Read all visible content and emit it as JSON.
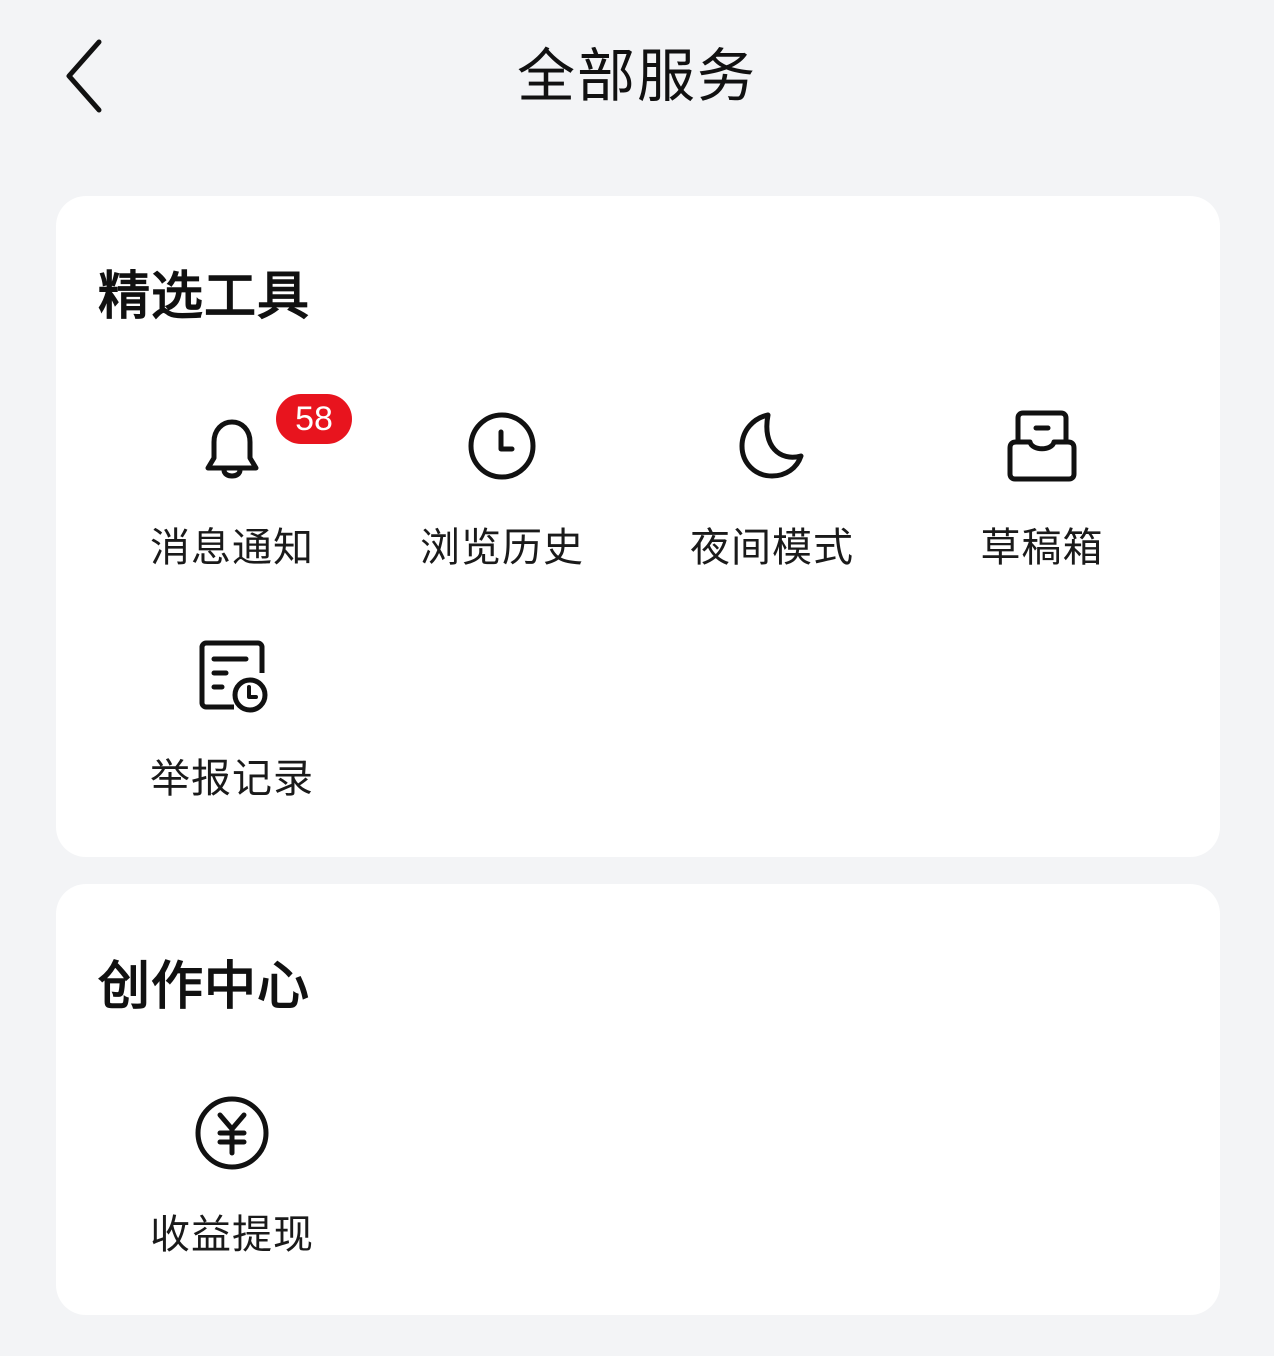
{
  "header": {
    "title": "全部服务",
    "back_icon": "chevron-left-icon"
  },
  "sections": [
    {
      "title": "精选工具",
      "items": [
        {
          "label": "消息通知",
          "icon": "bell-icon",
          "badge": "58"
        },
        {
          "label": "浏览历史",
          "icon": "clock-icon"
        },
        {
          "label": "夜间模式",
          "icon": "moon-icon"
        },
        {
          "label": "草稿箱",
          "icon": "inbox-icon"
        },
        {
          "label": "举报记录",
          "icon": "document-clock-icon"
        }
      ]
    },
    {
      "title": "创作中心",
      "items": [
        {
          "label": "收益提现",
          "icon": "yen-coin-icon"
        }
      ]
    }
  ],
  "colors": {
    "background": "#f3f4f6",
    "card": "#ffffff",
    "badge": "#e8141e",
    "text": "#111111"
  }
}
